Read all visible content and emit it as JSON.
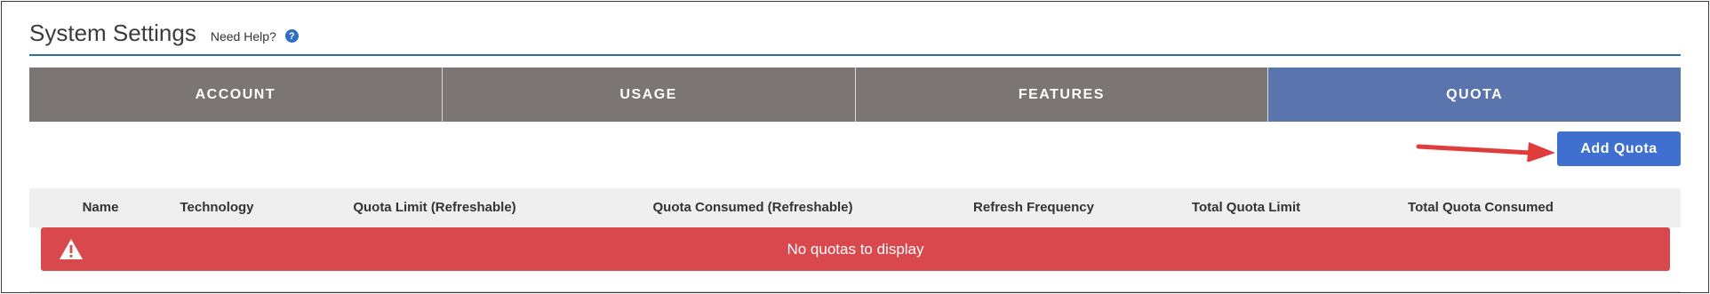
{
  "header": {
    "title": "System Settings",
    "help_text": "Need Help?",
    "help_icon": "?"
  },
  "tabs": [
    {
      "label": "ACCOUNT",
      "active": false
    },
    {
      "label": "USAGE",
      "active": false
    },
    {
      "label": "FEATURES",
      "active": false
    },
    {
      "label": "QUOTA",
      "active": true
    }
  ],
  "toolbar": {
    "add_label": "Add Quota",
    "annotation": "red-arrow pointing to Add Quota"
  },
  "table": {
    "columns": [
      "Name",
      "Technology",
      "Quota Limit (Refreshable)",
      "Quota Consumed (Refreshable)",
      "Refresh Frequency",
      "Total Quota Limit",
      "Total Quota Consumed"
    ],
    "empty_message": "No quotas to display"
  },
  "colors": {
    "tab_bg": "#7b7573",
    "tab_active_bg": "#5a74ad",
    "button_bg": "#3f6fcf",
    "alert_bg": "#d9484d",
    "accent_line": "#2f6fa8",
    "arrow": "#e03c3c"
  }
}
